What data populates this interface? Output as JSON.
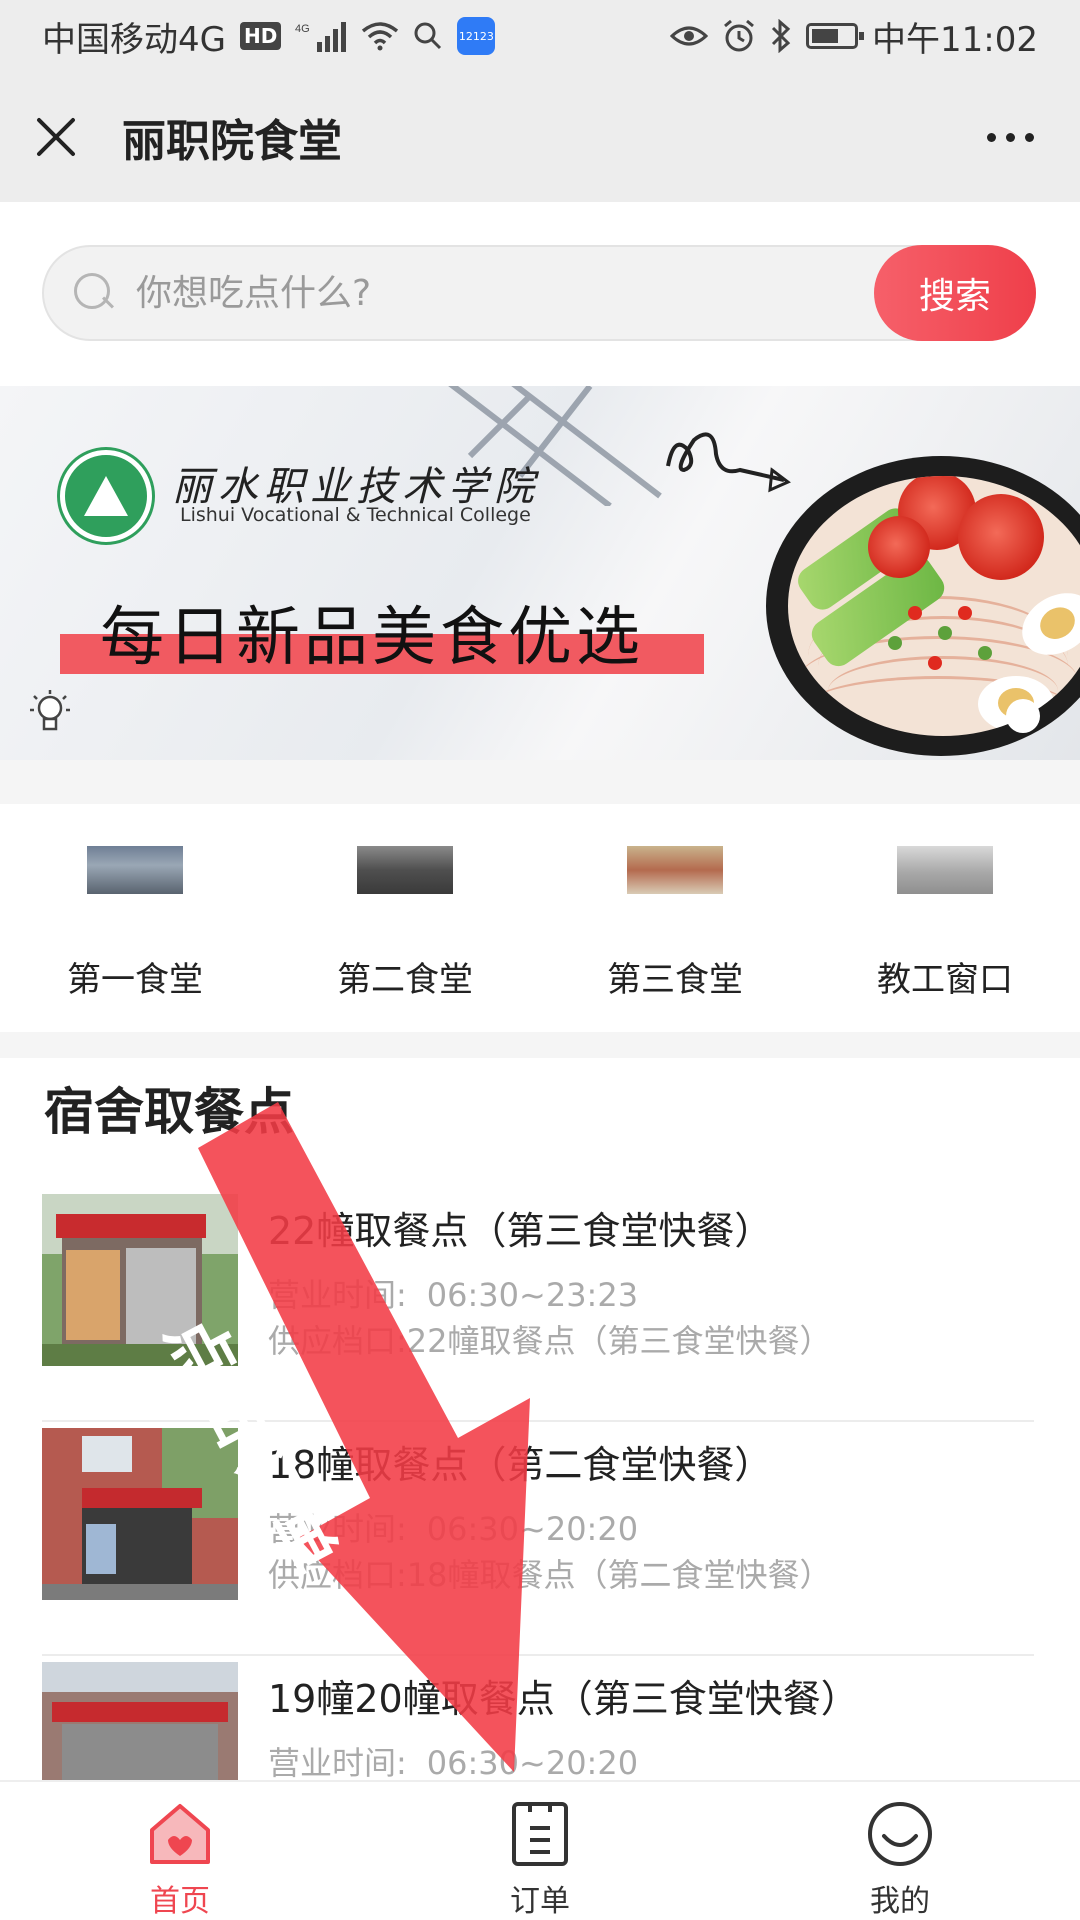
{
  "status_bar": {
    "carrier": "中国移动4G",
    "hd": "HD",
    "time": "中午11:02"
  },
  "title_bar": {
    "title": "丽职院食堂"
  },
  "search": {
    "placeholder": "你想吃点什么?",
    "button_label": "搜索"
  },
  "banner": {
    "college_name_cn": "丽水职业技术学院",
    "college_name_en": "Lishui Vocational & Technical College",
    "slogan": "每日新品美食优选"
  },
  "canteens": [
    {
      "label": "第一食堂"
    },
    {
      "label": "第二食堂"
    },
    {
      "label": "第三食堂"
    },
    {
      "label": "教工窗口"
    }
  ],
  "pickup": {
    "section_title": "宿舍取餐点",
    "hours_label": "营业时间:",
    "window_label": "供应档口:",
    "items": [
      {
        "name": "22幢取餐点（第三食堂快餐）",
        "hours": "06:30~23:23",
        "window": "22幢取餐点（第三食堂快餐）"
      },
      {
        "name": "18幢取餐点（第二食堂快餐）",
        "hours": "06:30~20:20",
        "window": "18幢取餐点（第二食堂快餐）"
      },
      {
        "name": "19幢20幢取餐点（第三食堂快餐）",
        "hours": "06:30~20:20",
        "window": ""
      }
    ]
  },
  "overlay": {
    "annotation": "点击订单"
  },
  "tab_bar": {
    "tabs": [
      {
        "label": "首页",
        "icon": "home-icon",
        "active": true
      },
      {
        "label": "订单",
        "icon": "order-icon",
        "active": false
      },
      {
        "label": "我的",
        "icon": "profile-icon",
        "active": false
      }
    ]
  },
  "colors": {
    "accent": "#ef4650",
    "banner_stripe": "#f15a61",
    "overlay_arrow": "#f23b45"
  }
}
